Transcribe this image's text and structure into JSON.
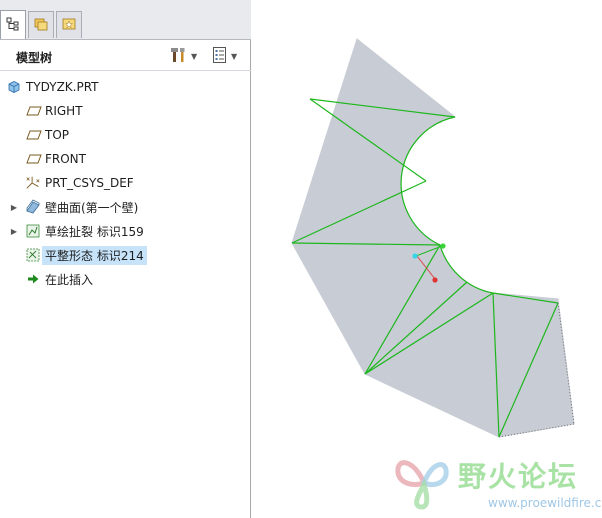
{
  "panel": {
    "tabs": [
      {
        "icon": "model-tree-icon"
      },
      {
        "icon": "folder-browser-icon"
      },
      {
        "icon": "favorites-icon"
      }
    ],
    "title": "模型树",
    "tools": [
      {
        "icon": "settings-tools-icon"
      },
      {
        "icon": "show-options-icon"
      }
    ]
  },
  "tree": {
    "items": [
      {
        "label": "TYDYZK.PRT",
        "icon": "part-icon",
        "expandable": false
      },
      {
        "label": "RIGHT",
        "icon": "datum-plane-icon",
        "expandable": false
      },
      {
        "label": "TOP",
        "icon": "datum-plane-icon",
        "expandable": false
      },
      {
        "label": "FRONT",
        "icon": "datum-plane-icon",
        "expandable": false
      },
      {
        "label": "PRT_CSYS_DEF",
        "icon": "coordinate-system-icon",
        "expandable": false
      },
      {
        "label": "壁曲面(第一个壁)",
        "icon": "sheetmetal-wall-icon",
        "expandable": true
      },
      {
        "label": "草绘扯裂 标识159",
        "icon": "sketched-rip-icon",
        "expandable": true
      },
      {
        "label": "平整形态 标识214",
        "icon": "flat-state-icon",
        "expandable": false,
        "selected": true
      },
      {
        "label": "在此插入",
        "icon": "insert-here-arrow-icon",
        "expandable": false
      }
    ]
  },
  "viewport": {
    "part_fill": "#c8ccd4",
    "edge_color": "#1db71d"
  },
  "watermark": {
    "title": "野火论坛",
    "url": "www.proewildfire.cn"
  }
}
